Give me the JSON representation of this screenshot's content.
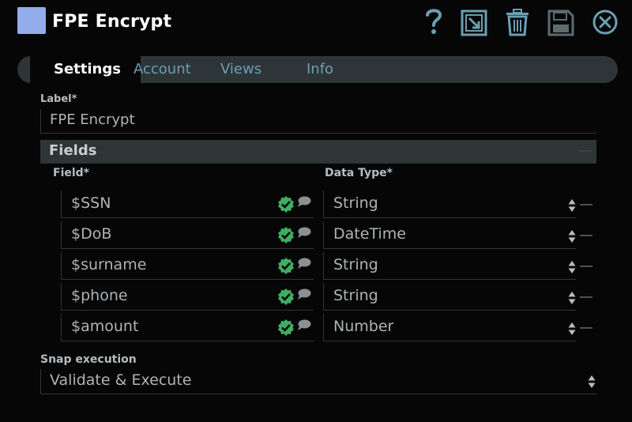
{
  "header": {
    "title": "FPE Encrypt",
    "swatch_color": "#92acec",
    "icons": [
      "help-icon",
      "export-icon",
      "trash-icon",
      "save-icon",
      "close-icon"
    ]
  },
  "tabs": [
    {
      "label": "Settings",
      "active": true
    },
    {
      "label": "Account",
      "active": false
    },
    {
      "label": "Views",
      "active": false
    },
    {
      "label": "Info",
      "active": false
    }
  ],
  "label_field": {
    "title": "Label*",
    "value": "FPE Encrypt"
  },
  "fields": {
    "section_title": "Fields",
    "field_header": "Field*",
    "type_header": "Data Type*",
    "rows": [
      {
        "field": "$SSN",
        "type": "String"
      },
      {
        "field": "$DoB",
        "type": "DateTime"
      },
      {
        "field": "$surname",
        "type": "String"
      },
      {
        "field": "$phone",
        "type": "String"
      },
      {
        "field": "$amount",
        "type": "Number"
      }
    ]
  },
  "snap_execution": {
    "title": "Snap execution",
    "value": "Validate & Execute"
  },
  "colors": {
    "accent": "#6b9fb3",
    "check": "#3fae62",
    "background": "#060606"
  }
}
